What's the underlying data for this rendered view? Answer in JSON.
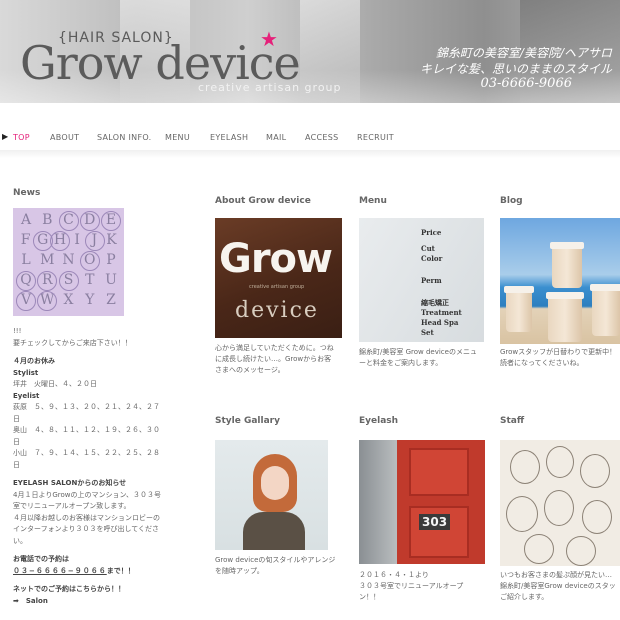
{
  "header": {
    "hair_salon": "{HAIR SALON}",
    "logo": "Grow device",
    "star": "★",
    "sub": "creative artisan group",
    "tagline1": "錦糸町の美容室/美容院/ヘアサロ",
    "tagline2": "キレイな髪、思いのままのスタイル",
    "phone": "03-6666-9066"
  },
  "nav": {
    "arrow": "▶",
    "items": [
      "TOP",
      "ABOUT",
      "SALON INFO.",
      "MENU",
      "EYELASH",
      "MAIL",
      "ACCESS",
      "RECRUIT"
    ],
    "active": "TOP"
  },
  "news": {
    "title": "News",
    "letters": [
      [
        "A",
        "B",
        "C",
        "D",
        "E"
      ],
      [
        "F",
        "G",
        "H",
        "I",
        "J",
        "K"
      ],
      [
        "L",
        "M",
        "N",
        "O",
        "P"
      ],
      [
        "Q",
        "R",
        "S",
        "T",
        "U"
      ],
      [
        "V",
        "W",
        "X",
        "Y",
        "Z"
      ]
    ],
    "lines": {
      "l1": "!!!",
      "l2": "要チェックしてからご来店下さい！！",
      "l3": "４月のお休み",
      "l4": "Stylist",
      "l5": "坪井　火曜日、４、２０日",
      "l6": "Eyelist",
      "l7": "荻原　５、９、１３、２０、２１、２４、２７",
      "l8": "日",
      "l9": "奥山　４、８、１１、１２、１９、２６、３０",
      "l10": "日",
      "l11": "小山　７、９、１４、１５、２２、２５、２８",
      "l12": "日",
      "l13": "EYELASH SALONからのお知らせ",
      "l14": "4月１日よりGrowの上のマンション、３０３号",
      "l15": "室でリニューアルオープン致します。",
      "l16": "４月以降お越しのお客様はマンションロビーの",
      "l17": "インターフォンより３０３を呼び出してくださ",
      "l18": "い。",
      "l19": "お電話での予約は",
      "l20": "０３−６６６６−９０６６",
      "l20b": "まで！！",
      "l21": "ネットでのご予約はこちらから！！",
      "l22": "➡　Salon"
    }
  },
  "about": {
    "title": "About Grow device",
    "img_grow": "Grow",
    "img_device": "device",
    "img_tiny": "creative artisan group",
    "caption1": "心から満足していただくために。つね",
    "caption2": "に成長し続けたい…。Growからお客",
    "caption3": "さまへのメッセージ。"
  },
  "menu": {
    "title": "Menu",
    "img": [
      "Price",
      "Cut",
      "Color",
      "Perm",
      "縮毛矯正",
      "Treatment",
      "Head Spa",
      "Set"
    ],
    "caption1": "錦糸町/美容室 Grow deviceのメニュ",
    "caption2": "ーと料金をご案内します。"
  },
  "blog": {
    "title": "Blog",
    "caption1": "Growスタッフが日替わりで更新中！",
    "caption2": "読者になってくださいね。"
  },
  "style": {
    "title": "Style Gallary",
    "caption1": "Grow deviceの旬スタイルやアレンジ",
    "caption2": "を随時アップ。"
  },
  "eyelash": {
    "title": "Eyelash",
    "door_number": "303",
    "caption1": "２０１６・４・１より",
    "caption2": "３０３号室でリニューアルオープ",
    "caption3": "ン！！"
  },
  "staff": {
    "title": "Staff",
    "caption1": "いつもお客さまの髪ぷ顔が見たい…",
    "caption2": "錦糸町/美容室Grow deviceのスタッ",
    "caption3": "ご紹介します。"
  },
  "colors": {
    "accent": "#e5217a",
    "text": "#666666"
  }
}
